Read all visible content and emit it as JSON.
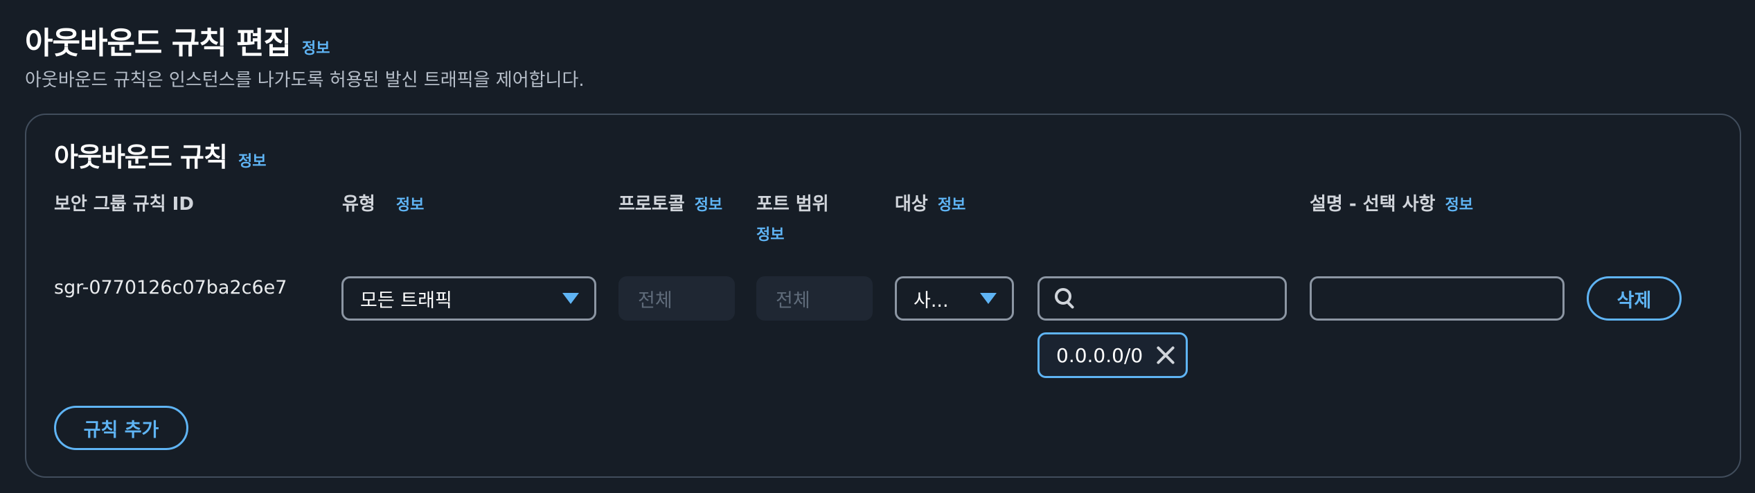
{
  "page": {
    "title": "아웃바운드 규칙 편집",
    "title_info": "정보",
    "description": "아웃바운드 규칙은 인스턴스를 나가도록 허용된 발신 트래픽을 제어합니다."
  },
  "card": {
    "title": "아웃바운드 규칙",
    "title_info": "정보",
    "columns": {
      "rule_id": "보안 그룹 규칙 ID",
      "type": "유형",
      "type_info": "정보",
      "protocol": "프로토콜",
      "protocol_info": "정보",
      "port_range": "포트 범위",
      "port_range_info": "정보",
      "destination": "대상",
      "destination_info": "정보",
      "description": "설명 - 선택 사항",
      "description_info": "정보"
    },
    "rule": {
      "id": "sgr-0770126c07ba2c6e7",
      "type_value": "모든 트래픽",
      "protocol_value": "전체",
      "port_value": "전체",
      "destination_type": "사...",
      "search_value": "",
      "cidr_token": "0.0.0.0/0",
      "description_value": "",
      "delete_label": "삭제"
    },
    "add_rule_label": "규칙 추가"
  },
  "colors": {
    "background": "#161d26",
    "accent": "#5fb4f4",
    "border": "#8c96a3",
    "card_border": "#414d5c"
  },
  "icons": [
    "caret-down-icon",
    "search-icon",
    "close-icon"
  ]
}
